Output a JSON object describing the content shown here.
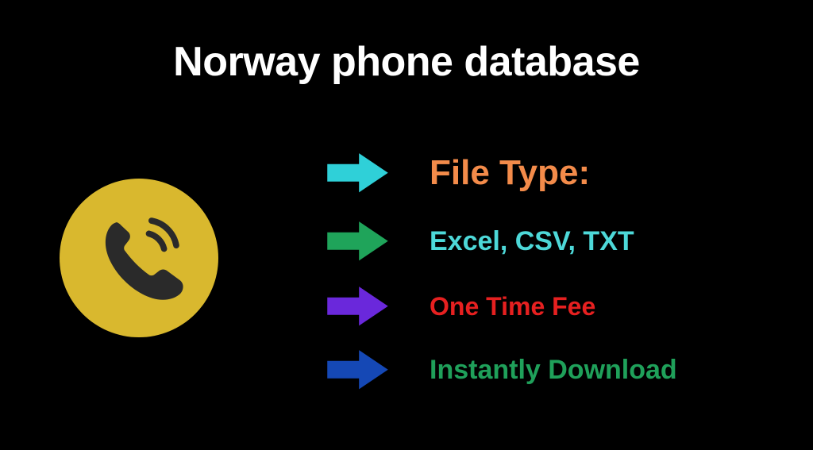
{
  "title": "Norway phone database",
  "features": {
    "heading": "File Type:",
    "formats": "Excel, CSV, TXT",
    "fee": "One Time Fee",
    "download": "Instantly Download"
  },
  "colors": {
    "arrow1": "#2fd0d8",
    "arrow2": "#1fa45a",
    "arrow3": "#6a28db",
    "arrow4": "#1548b5",
    "circle": "#d9b82e"
  }
}
